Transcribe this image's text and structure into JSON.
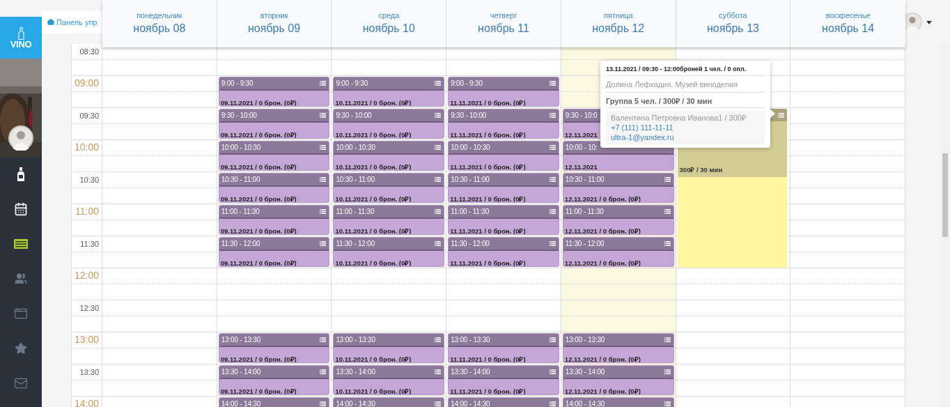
{
  "sidebar": {
    "logo": "VINO",
    "items": [
      {
        "kind": "bottle",
        "selected": false
      },
      {
        "kind": "calendar",
        "selected": false
      },
      {
        "kind": "list",
        "selected": true
      },
      {
        "kind": "users",
        "selected": false
      },
      {
        "kind": "window",
        "selected": false
      },
      {
        "kind": "star",
        "selected": false
      },
      {
        "kind": "mail",
        "selected": false
      }
    ]
  },
  "breadcrumb": {
    "text": "Панель упр"
  },
  "days": [
    {
      "weekday": "понедельник",
      "date": "ноябрь 08",
      "today": false
    },
    {
      "weekday": "вторник",
      "date": "ноябрь 09",
      "today": false
    },
    {
      "weekday": "среда",
      "date": "ноябрь 10",
      "today": false
    },
    {
      "weekday": "четверг",
      "date": "ноябрь 11",
      "today": false
    },
    {
      "weekday": "пятница",
      "date": "ноябрь 12",
      "today": true
    },
    {
      "weekday": "суббота",
      "date": "ноябрь 13",
      "today": false
    },
    {
      "weekday": "воскресенье",
      "date": "ноябрь 14",
      "today": false
    }
  ],
  "rows": [
    {
      "time": "08:30",
      "kind": "half",
      "cells": [
        {
          "kind": "empty"
        },
        {
          "kind": "empty"
        },
        {
          "kind": "empty"
        },
        {
          "kind": "empty"
        },
        {
          "kind": "empty"
        },
        {
          "kind": "empty"
        },
        {
          "kind": "empty"
        }
      ]
    },
    {
      "time": "09:00",
      "kind": "hour",
      "cells": [
        {
          "kind": "empty"
        },
        {
          "kind": "slot",
          "time": "9:00 - 9:30",
          "info": "09.11.2021 / 0 брон. (0₽)"
        },
        {
          "kind": "slot",
          "time": "9:00 - 9:30",
          "info": "10.11.2021 / 0 брон. (0₽)"
        },
        {
          "kind": "slot",
          "time": "9:00 - 9:30",
          "info": "11.11.2021 / 0 брон. (0₽)"
        },
        {
          "kind": "empty"
        },
        {
          "kind": "empty"
        },
        {
          "kind": "empty"
        }
      ]
    },
    {
      "time": "09:30",
      "kind": "half",
      "cells": [
        {
          "kind": "empty"
        },
        {
          "kind": "slot",
          "time": "9:30 - 10:00",
          "info": "09.11.2021 / 0 брон. (0₽)"
        },
        {
          "kind": "slot",
          "time": "9:30 - 10:00",
          "info": "10.11.2021 / 0 брон. (0₽)"
        },
        {
          "kind": "slot",
          "time": "9:30 - 10:00",
          "info": "11.11.2021 / 0 брон. (0₽)"
        },
        {
          "kind": "slot_covered",
          "time": "9:30 - 10:0",
          "info": "12.11.2021"
        },
        {
          "kind": "booked",
          "info": "300₽ / 30 мин"
        },
        {
          "kind": "empty"
        }
      ]
    },
    {
      "time": "10:00",
      "kind": "hour",
      "cells": [
        {
          "kind": "empty"
        },
        {
          "kind": "slot",
          "time": "10:00 - 10:30",
          "info": "09.11.2021 / 0 брон. (0₽)"
        },
        {
          "kind": "slot",
          "time": "10:00 - 10:30",
          "info": "10.11.2021 / 0 брон. (0₽)"
        },
        {
          "kind": "slot",
          "time": "10:00 - 10:30",
          "info": "11.11.2021 / 0 брон. (0₽)"
        },
        {
          "kind": "slot_covered",
          "time": "10:00 - 10:",
          "info": "12.11.2021"
        },
        {
          "kind": "continued"
        },
        {
          "kind": "empty"
        }
      ]
    },
    {
      "time": "10:30",
      "kind": "half",
      "cells": [
        {
          "kind": "empty"
        },
        {
          "kind": "slot",
          "time": "10:30 - 11:00",
          "info": "09.11.2021 / 0 брон. (0₽)"
        },
        {
          "kind": "slot",
          "time": "10:30 - 11:00",
          "info": "10.11.2021 / 0 брон. (0₽)"
        },
        {
          "kind": "slot",
          "time": "10:30 - 11:00",
          "info": "11.11.2021 / 0 брон. (0₽)"
        },
        {
          "kind": "slot",
          "time": "10:30 - 11:00",
          "info": "12.11.2021 / 0 брон. (0₽)"
        },
        {
          "kind": "continued"
        },
        {
          "kind": "empty"
        }
      ]
    },
    {
      "time": "11:00",
      "kind": "hour",
      "cells": [
        {
          "kind": "empty"
        },
        {
          "kind": "slot",
          "time": "11:00 - 11:30",
          "info": "09.11.2021 / 0 брон. (0₽)"
        },
        {
          "kind": "slot",
          "time": "11:00 - 11:30",
          "info": "10.11.2021 / 0 брон. (0₽)"
        },
        {
          "kind": "slot",
          "time": "11:00 - 11:30",
          "info": "11.11.2021 / 0 брон. (0₽)"
        },
        {
          "kind": "slot",
          "time": "11:00 - 11:30",
          "info": "12.11.2021 / 0 брон. (0₽)"
        },
        {
          "kind": "continued"
        },
        {
          "kind": "empty"
        }
      ]
    },
    {
      "time": "11:30",
      "kind": "half",
      "cells": [
        {
          "kind": "empty"
        },
        {
          "kind": "slot",
          "time": "11:30 - 12:00",
          "info": "09.11.2021 / 0 брон. (0₽)"
        },
        {
          "kind": "slot",
          "time": "11:30 - 12:00",
          "info": "10.11.2021 / 0 брон. (0₽)"
        },
        {
          "kind": "slot",
          "time": "11:30 - 12:00",
          "info": "11.11.2021 / 0 брон. (0₽)"
        },
        {
          "kind": "slot",
          "time": "11:30 - 12:00",
          "info": "12.11.2021 / 0 брон. (0₽)"
        },
        {
          "kind": "continued"
        },
        {
          "kind": "empty"
        }
      ]
    },
    {
      "time": "12:00",
      "kind": "hour",
      "cells": [
        {
          "kind": "empty"
        },
        {
          "kind": "empty"
        },
        {
          "kind": "empty"
        },
        {
          "kind": "empty"
        },
        {
          "kind": "empty"
        },
        {
          "kind": "empty"
        },
        {
          "kind": "empty"
        }
      ]
    },
    {
      "time": "12:30",
      "kind": "half",
      "cells": [
        {
          "kind": "empty"
        },
        {
          "kind": "empty"
        },
        {
          "kind": "empty"
        },
        {
          "kind": "empty"
        },
        {
          "kind": "empty"
        },
        {
          "kind": "empty"
        },
        {
          "kind": "empty"
        }
      ]
    },
    {
      "time": "13:00",
      "kind": "hour",
      "cells": [
        {
          "kind": "empty"
        },
        {
          "kind": "slot",
          "time": "13:00 - 13:30",
          "info": "09.11.2021 / 0 брон. (0₽)"
        },
        {
          "kind": "slot",
          "time": "13:00 - 13:30",
          "info": "10.11.2021 / 0 брон. (0₽)"
        },
        {
          "kind": "slot",
          "time": "13:00 - 13:30",
          "info": "11.11.2021 / 0 брон. (0₽)"
        },
        {
          "kind": "slot",
          "time": "13:00 - 13:30",
          "info": "12.11.2021 / 0 брон. (0₽)"
        },
        {
          "kind": "empty"
        },
        {
          "kind": "empty"
        }
      ]
    },
    {
      "time": "13:30",
      "kind": "half",
      "cells": [
        {
          "kind": "empty"
        },
        {
          "kind": "slot",
          "time": "13:30 - 14:00",
          "info": "09.11.2021 / 0 брон. (0₽)"
        },
        {
          "kind": "slot",
          "time": "13:30 - 14:00",
          "info": "10.11.2021 / 0 брон. (0₽)"
        },
        {
          "kind": "slot",
          "time": "13:30 - 14:00",
          "info": "11.11.2021 / 0 брон. (0₽)"
        },
        {
          "kind": "slot",
          "time": "13:30 - 14:00",
          "info": "12.11.2021 / 0 брон. (0₽)"
        },
        {
          "kind": "empty"
        },
        {
          "kind": "empty"
        }
      ]
    },
    {
      "time": "14:00",
      "kind": "hour",
      "cells": [
        {
          "kind": "empty"
        },
        {
          "kind": "slot",
          "time": "14:00 - 14:30"
        },
        {
          "kind": "slot",
          "time": "14:00 - 14:30"
        },
        {
          "kind": "slot",
          "time": "14:00 - 14:30"
        },
        {
          "kind": "slot",
          "time": "14:00 - 14:30"
        },
        {
          "kind": "empty"
        },
        {
          "kind": "empty"
        }
      ]
    }
  ],
  "popover": {
    "title": "13.11.2021 / 09:30 - 12:00броней 1 чел. / 0 опл.",
    "venue": "Долина Лефкадия. Музей виноделия",
    "group": "Группа 5 чел. / 300₽ / 30 мин",
    "client": {
      "name": "Валентина Петровна Иванова1 / 300₽",
      "phone": "+7 (111) 111-11-11",
      "email": "ultra-1@yandex.ru"
    }
  }
}
